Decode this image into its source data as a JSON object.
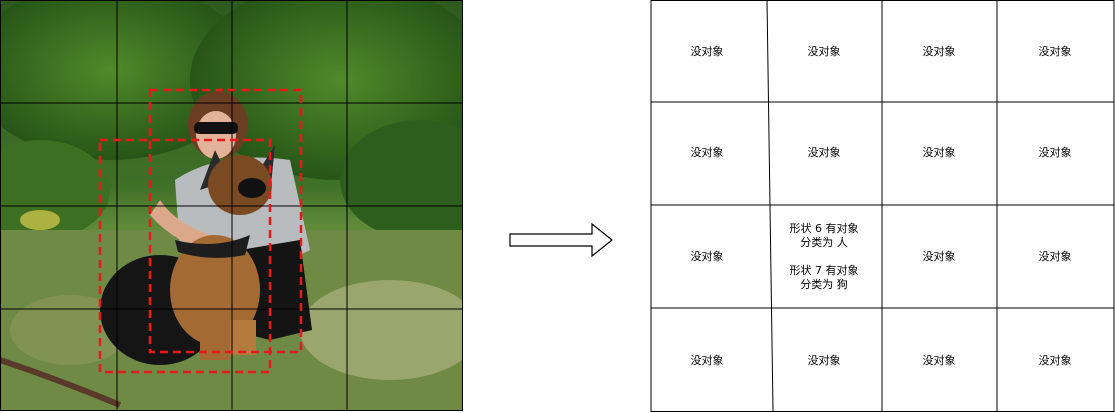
{
  "left_image": {
    "description_icon": "photo-woman-hugging-german-shepherd",
    "grid_rows": 4,
    "grid_cols": 4,
    "box_color": "#e8191b",
    "grid_color": "#000000"
  },
  "arrow": {
    "icon": "right-arrow-outline"
  },
  "right_grid": {
    "rows": 4,
    "cols": 4,
    "cells": [
      [
        "没对象",
        "没对象",
        "没对象",
        "没对象"
      ],
      [
        "没对象",
        "没对象",
        "没对象",
        "没对象"
      ],
      [
        "没对象",
        {
          "lines": [
            "形状 6 有对象",
            "分类为 人",
            "",
            "形状 7 有对象",
            "分类为 狗"
          ]
        },
        "没对象",
        "没对象"
      ],
      [
        "没对象",
        "没对象",
        "没对象",
        "没对象"
      ]
    ]
  }
}
